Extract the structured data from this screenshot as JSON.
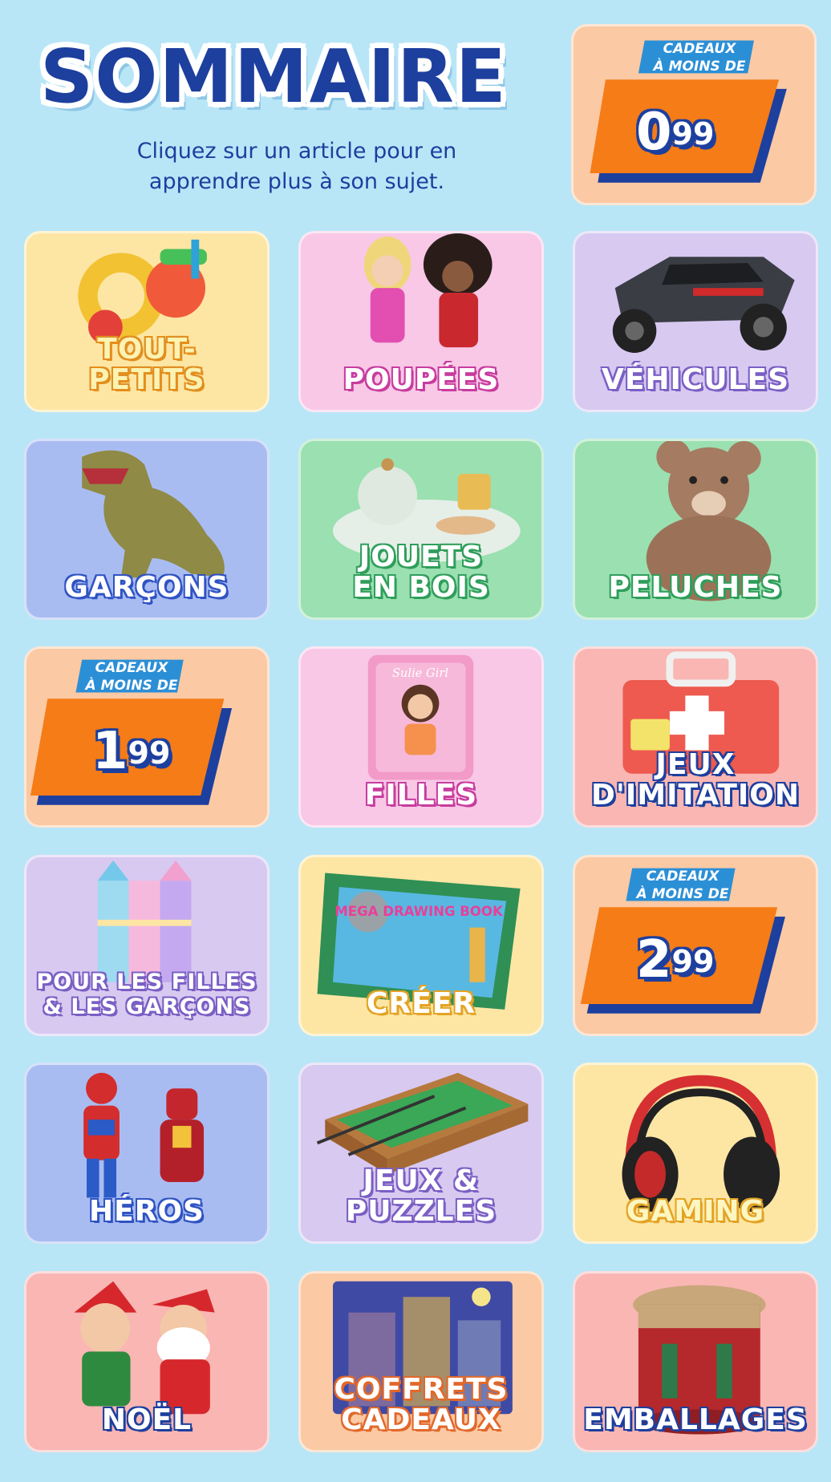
{
  "header": {
    "title": "SOMMAIRE",
    "subtitle": "Cliquez sur un article pour en apprendre plus à son sujet."
  },
  "price_badges": [
    {
      "caption_line1": "CADEAUX",
      "caption_line2": "À MOINS DE",
      "price_int": "0",
      "price_dec": "99"
    },
    {
      "caption_line1": "CADEAUX",
      "caption_line2": "À MOINS DE",
      "price_int": "1",
      "price_dec": "99"
    },
    {
      "caption_line1": "CADEAUX",
      "caption_line2": "À MOINS DE",
      "price_int": "2",
      "price_dec": "99"
    }
  ],
  "tiles": [
    {
      "label": "TOUT-\nPETITS"
    },
    {
      "label": "POUPÉES"
    },
    {
      "label": "VÉHICULES"
    },
    {
      "label": "GARÇONS"
    },
    {
      "label": "JOUETS\nEN BOIS"
    },
    {
      "label": "PELUCHES"
    },
    {
      "label": "FILLES"
    },
    {
      "label": "JEUX\nD'IMITATION"
    },
    {
      "label": "POUR LES FILLES\n& LES GARÇONS"
    },
    {
      "label": "CRÉER"
    },
    {
      "label": "HÉROS"
    },
    {
      "label": "JEUX &\nPUZZLES"
    },
    {
      "label": "GAMING"
    },
    {
      "label": "NOËL"
    },
    {
      "label": "COFFRETS\nCADEAUX"
    },
    {
      "label": "EMBALLAGES"
    }
  ],
  "art_text": {
    "drawing_book": "MEGA DRAWING BOOK",
    "folder": "Sulie Girl"
  },
  "colors": {
    "background": "#b9e6f7",
    "title_blue": "#1d3f9e",
    "badge_orange": "#f57c17",
    "yellow_tile": "#fde6a4",
    "pink_tile": "#f8c8e6",
    "purple_tile": "#d8c9f1",
    "blue_tile": "#a9bcf2",
    "green_tile": "#9be0b0",
    "peach_tile": "#fbc9a3",
    "red_tile": "#f9b6b3"
  }
}
